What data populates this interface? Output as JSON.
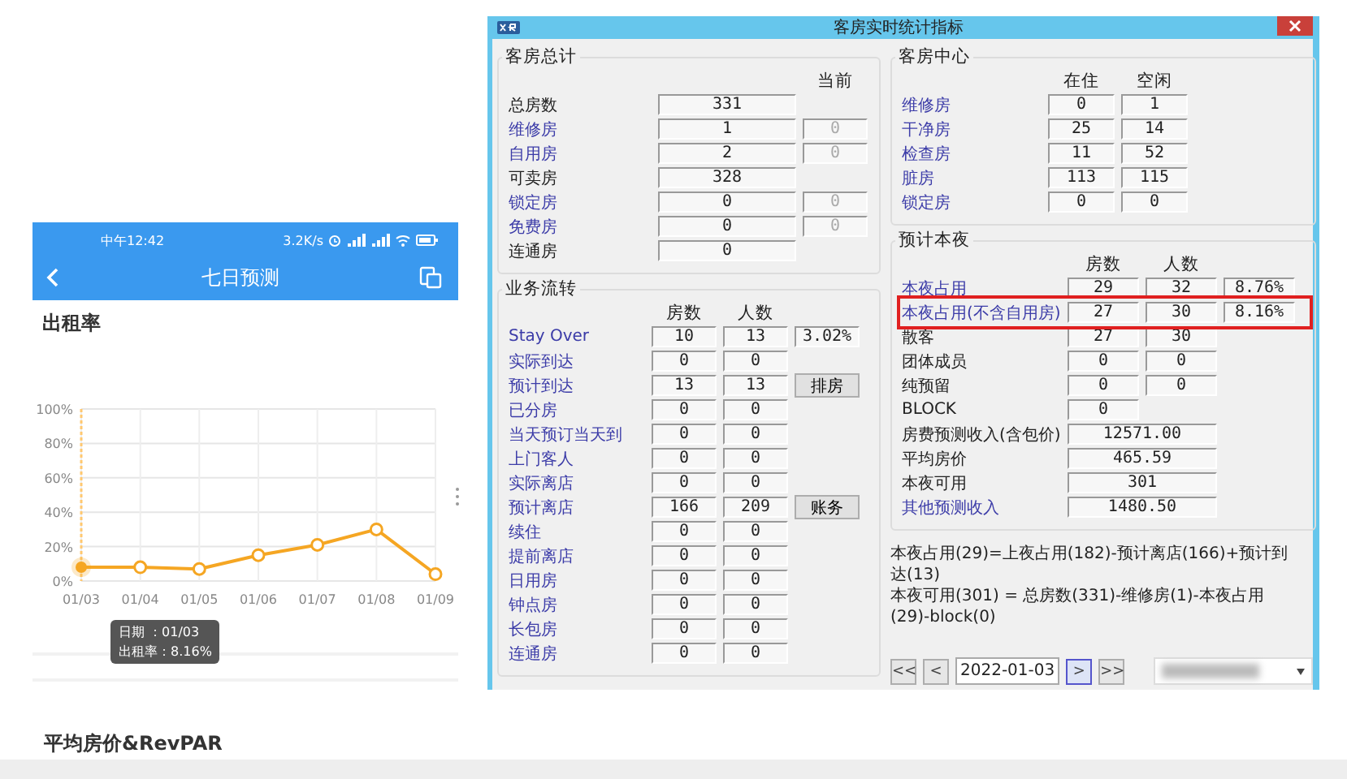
{
  "phone": {
    "status_bar": {
      "time": "中午12:42",
      "speed": "3.2K/s"
    },
    "header": {
      "title": "七日预测"
    },
    "sections": [
      {
        "title": "出租率",
        "points": [
          {
            "selected": true
          },
          {
            "selected": false
          },
          {
            "selected": false
          },
          {
            "selected": false
          },
          {
            "selected": false
          },
          {
            "selected": false
          },
          {
            "selected": false
          }
        ],
        "tooltip": {
          "lines": [
            "日期 ：01/03",
            "出租率：8.16%"
          ]
        },
        "chart_data": {
          "type": "line",
          "grid": true,
          "categories": [
            "01/03",
            "01/04",
            "01/05",
            "01/06",
            "01/07",
            "01/08",
            "01/09"
          ],
          "series": [
            {
              "color": "#f5a623",
              "marker": true,
              "values": [
                8,
                8,
                7,
                15,
                21,
                30,
                4
              ]
            }
          ],
          "ylim": [
            0,
            100
          ],
          "yticks": [
            {
              "value": 0,
              "label": "0%"
            },
            {
              "value": 20,
              "label": "20%"
            },
            {
              "value": 40,
              "label": "40%"
            },
            {
              "value": 60,
              "label": "60%"
            },
            {
              "value": 80,
              "label": "80%"
            },
            {
              "value": 100,
              "label": "100%"
            }
          ]
        }
      },
      {
        "title": "平均房价&RevPAR"
      }
    ]
  },
  "dialog": {
    "title": "客房实时统计指标",
    "left_column": {
      "groups": [
        {
          "kind": "totals",
          "title": "客房总计",
          "headings": [
            "当前"
          ],
          "rows": [
            {
              "label": "总房数",
              "link": false,
              "values": [
                "331"
              ]
            },
            {
              "label": "维修房",
              "link": true,
              "values": [
                "1"
              ],
              "current": "0"
            },
            {
              "label": "自用房",
              "link": true,
              "values": [
                "2"
              ],
              "current": "0"
            },
            {
              "label": "可卖房",
              "link": false,
              "values": [
                "328"
              ]
            },
            {
              "label": "锁定房",
              "link": true,
              "values": [
                "0"
              ],
              "current": "0"
            },
            {
              "label": "免费房",
              "link": true,
              "values": [
                "0"
              ],
              "current": "0"
            },
            {
              "label": "连通房",
              "link": false,
              "values": [
                "0"
              ]
            }
          ]
        },
        {
          "kind": "flow",
          "title": "业务流转",
          "headings": [
            "房数",
            "人数"
          ],
          "rows": [
            {
              "label": "Stay Over",
              "link": true,
              "values": [
                "10",
                "13",
                "3.02%"
              ]
            },
            {
              "label": "实际到达",
              "link": true,
              "values": [
                "0",
                "0"
              ]
            },
            {
              "label": "预计到达",
              "link": true,
              "values": [
                "13",
                "13"
              ],
              "button": "排房"
            },
            {
              "label": "已分房",
              "link": true,
              "values": [
                "0",
                "0"
              ]
            },
            {
              "label": "当天预订当天到",
              "link": true,
              "values": [
                "0",
                "0"
              ]
            },
            {
              "label": "上门客人",
              "link": true,
              "values": [
                "0",
                "0"
              ]
            },
            {
              "label": "实际离店",
              "link": true,
              "values": [
                "0",
                "0"
              ]
            },
            {
              "label": "预计离店",
              "link": true,
              "values": [
                "166",
                "209"
              ],
              "button": "账务"
            },
            {
              "label": "续住",
              "link": true,
              "values": [
                "0",
                "0"
              ]
            },
            {
              "label": "提前离店",
              "link": true,
              "values": [
                "0",
                "0"
              ]
            },
            {
              "label": "日用房",
              "link": true,
              "values": [
                "0",
                "0"
              ]
            },
            {
              "label": "钟点房",
              "link": true,
              "values": [
                "0",
                "0"
              ]
            },
            {
              "label": "长包房",
              "link": true,
              "values": [
                "0",
                "0"
              ]
            },
            {
              "label": "连通房",
              "link": true,
              "values": [
                "0",
                "0"
              ]
            }
          ]
        }
      ]
    },
    "right_column": {
      "groups": [
        {
          "kind": "center",
          "title": "客房中心",
          "headings": [
            "在住",
            "空闲"
          ],
          "rows": [
            {
              "label": "维修房",
              "link": true,
              "values": [
                "0",
                "1"
              ]
            },
            {
              "label": "干净房",
              "link": true,
              "values": [
                "25",
                "14"
              ]
            },
            {
              "label": "检查房",
              "link": true,
              "values": [
                "11",
                "52"
              ]
            },
            {
              "label": "脏房",
              "link": true,
              "values": [
                "113",
                "115"
              ]
            },
            {
              "label": "锁定房",
              "link": true,
              "values": [
                "0",
                "0"
              ]
            }
          ]
        },
        {
          "kind": "tonight",
          "title": "预计本夜",
          "headings": [
            "房数",
            "人数"
          ],
          "rows": [
            {
              "label": "本夜占用",
              "link": true,
              "kind": "count",
              "highlighted": false,
              "values": [
                "29",
                "32",
                "8.76%"
              ]
            },
            {
              "label": "本夜占用(不含自用房)",
              "link": true,
              "kind": "count",
              "highlighted": true,
              "values": [
                "27",
                "30",
                "8.16%"
              ]
            },
            {
              "label": "散客",
              "link": false,
              "kind": "count",
              "highlighted": false,
              "values": [
                "27",
                "30"
              ]
            },
            {
              "label": "团体成员",
              "link": false,
              "kind": "count",
              "highlighted": false,
              "values": [
                "0",
                "0"
              ]
            },
            {
              "label": "纯预留",
              "link": false,
              "kind": "count",
              "highlighted": false,
              "values": [
                "0",
                "0"
              ]
            },
            {
              "label": "BLOCK",
              "link": false,
              "kind": "count",
              "highlighted": false,
              "values": [
                "0"
              ]
            },
            {
              "label": "房费预测收入(含包价)",
              "link": false,
              "kind": "amount",
              "highlighted": false,
              "values": [
                "12571.00"
              ]
            },
            {
              "label": "平均房价",
              "link": false,
              "kind": "amount",
              "highlighted": false,
              "values": [
                "465.59"
              ]
            },
            {
              "label": "本夜可用",
              "link": false,
              "kind": "amount",
              "highlighted": false,
              "values": [
                "301"
              ]
            },
            {
              "label": "其他预测收入",
              "link": true,
              "kind": "amount",
              "highlighted": false,
              "values": [
                "1480.50"
              ]
            }
          ]
        }
      ],
      "notes": [
        "本夜占用(29)=上夜占用(182)-预计离店(166)+预计到达(13)",
        "本夜可用(301) = 总房数(331)-维修房(1)-本夜占用(29)-block(0)"
      ],
      "navigator": [
        {
          "kind": "button",
          "text": "<<",
          "focused": false
        },
        {
          "kind": "button",
          "text": "<",
          "focused": false
        },
        {
          "kind": "date",
          "value": "2022-01-03"
        },
        {
          "kind": "button",
          "text": ">",
          "focused": true
        },
        {
          "kind": "button",
          "text": ">>",
          "focused": false
        },
        {
          "kind": "dropdown"
        }
      ]
    }
  }
}
